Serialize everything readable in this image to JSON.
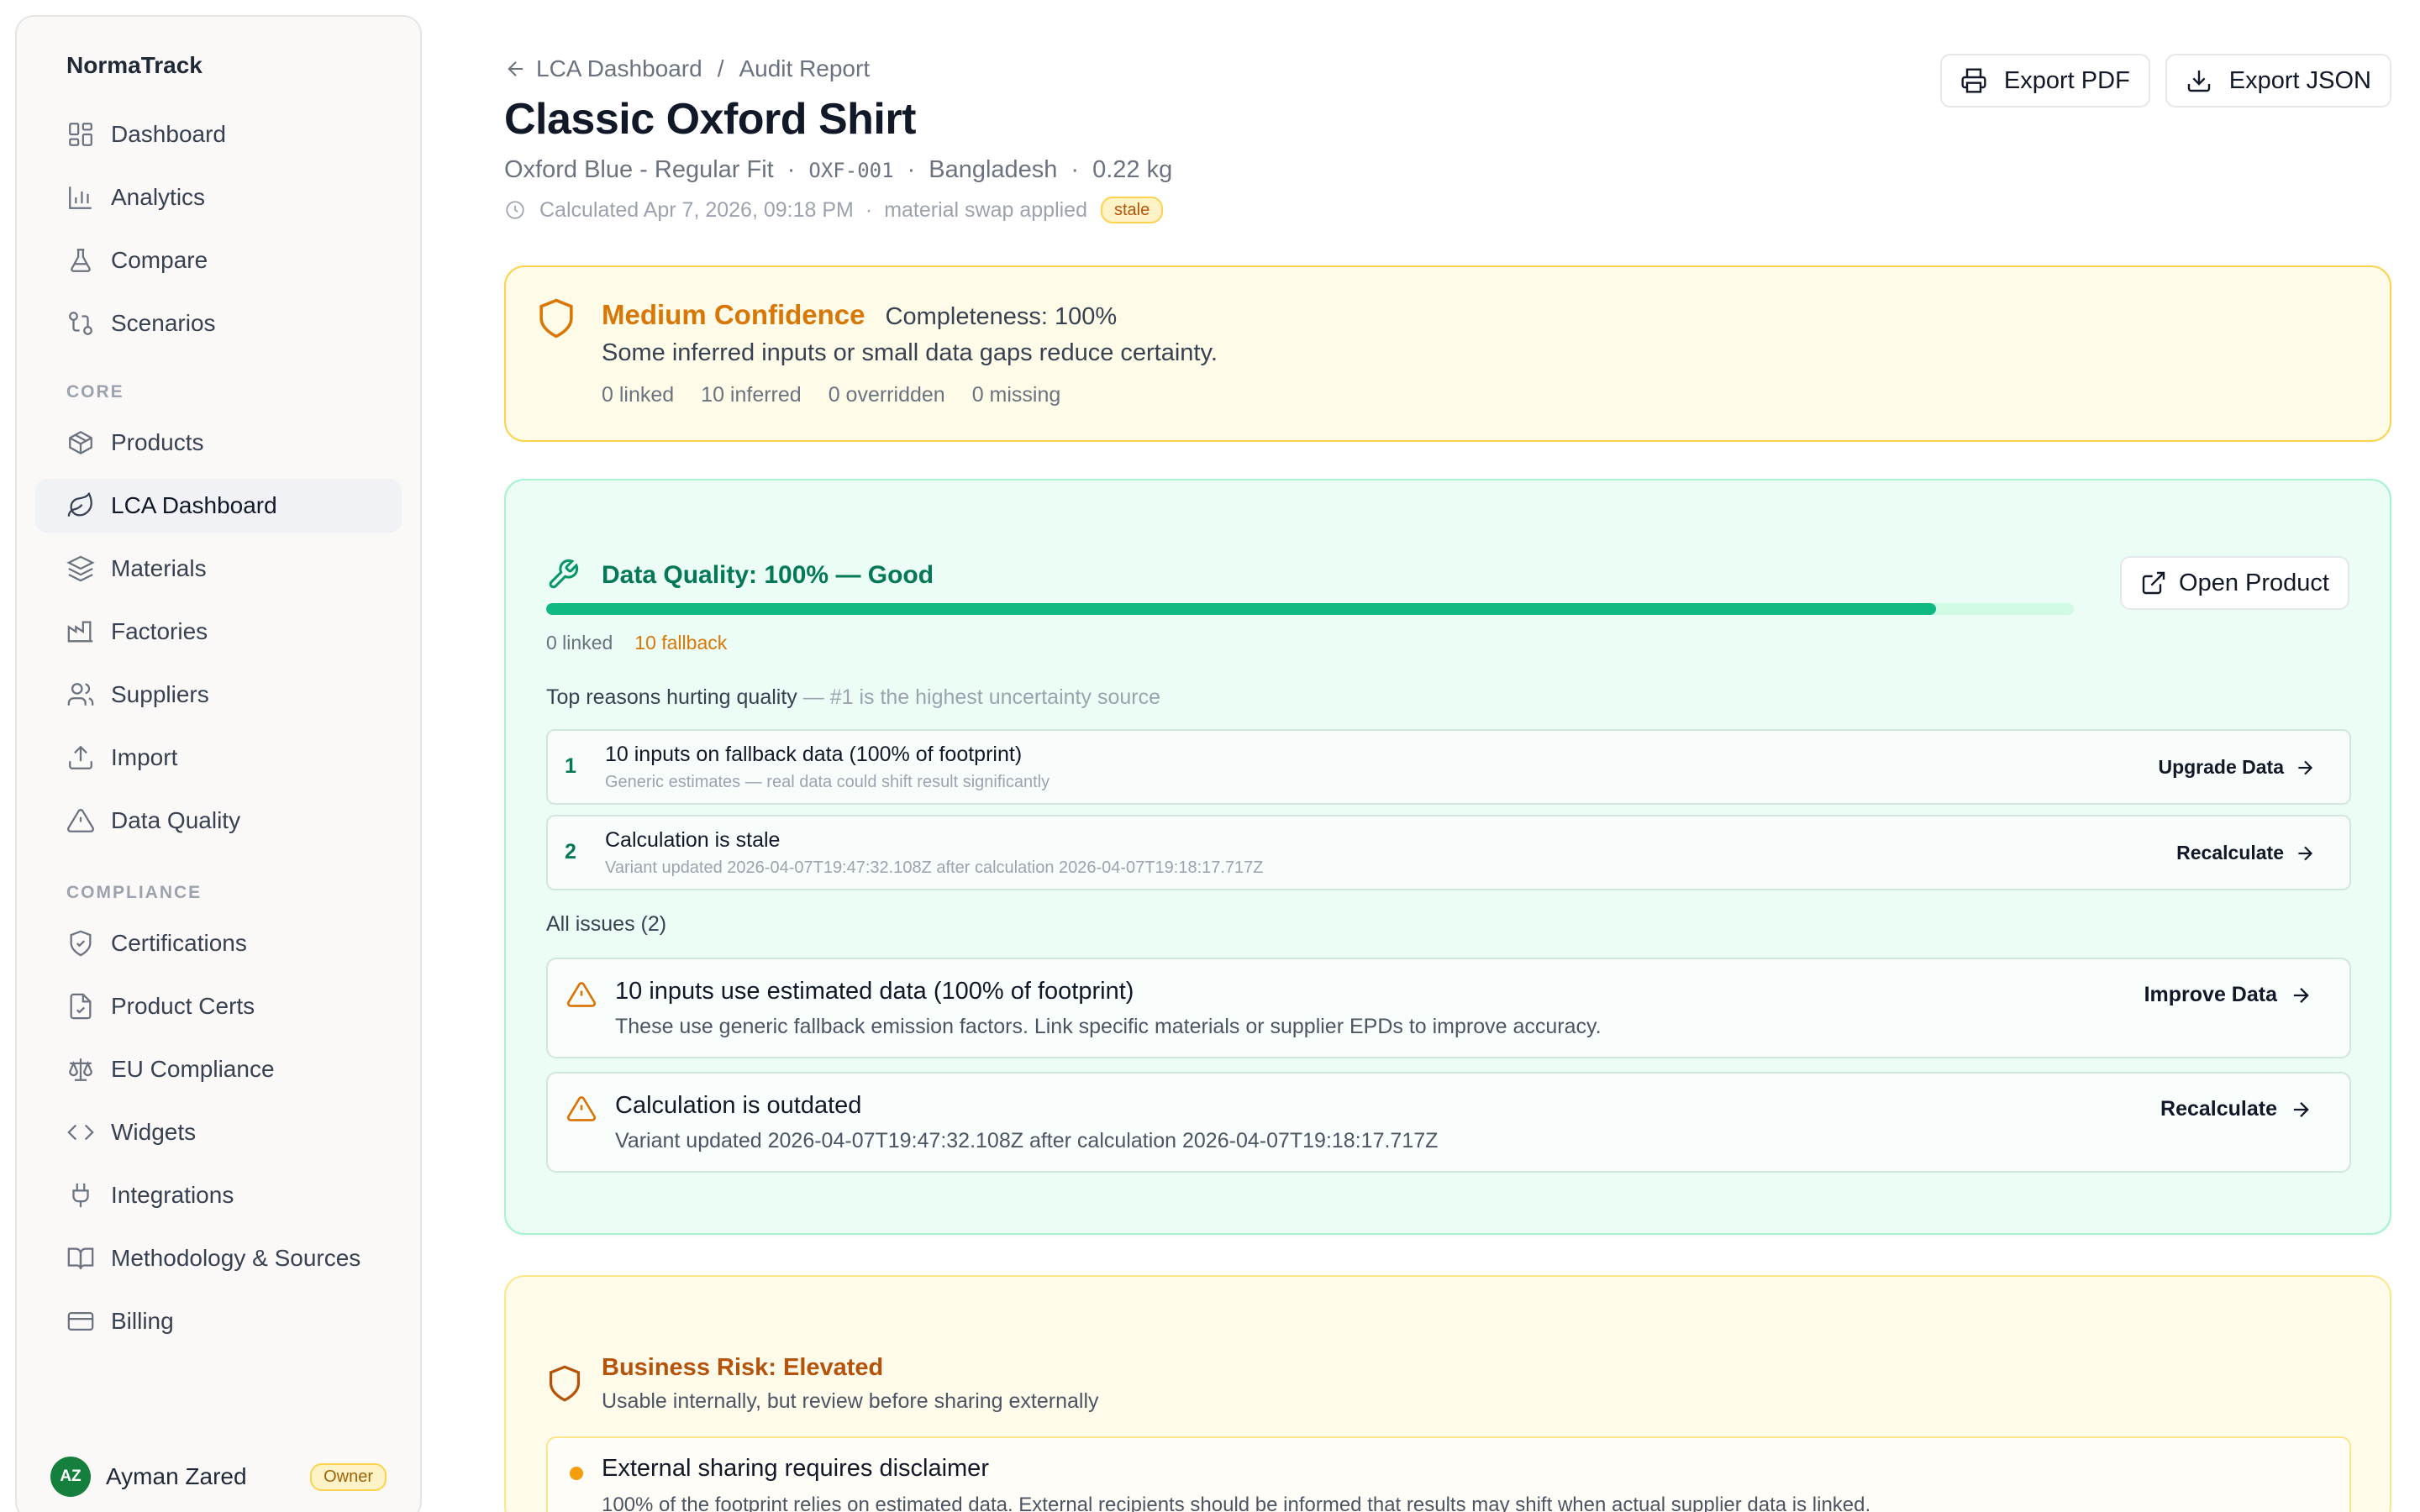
{
  "sidebar": {
    "brand": "NormaTrack",
    "top_items": [
      {
        "label": "Dashboard"
      },
      {
        "label": "Analytics"
      },
      {
        "label": "Compare"
      },
      {
        "label": "Scenarios"
      }
    ],
    "core_section": "CORE",
    "core_items": [
      {
        "label": "Products"
      },
      {
        "label": "LCA Dashboard"
      },
      {
        "label": "Materials"
      },
      {
        "label": "Factories"
      },
      {
        "label": "Suppliers"
      },
      {
        "label": "Import"
      },
      {
        "label": "Data Quality"
      }
    ],
    "compliance_section": "COMPLIANCE",
    "compliance_items": [
      {
        "label": "Certifications"
      },
      {
        "label": "Product Certs"
      },
      {
        "label": "EU Compliance"
      },
      {
        "label": "Widgets"
      },
      {
        "label": "Integrations"
      },
      {
        "label": "Methodology & Sources"
      },
      {
        "label": "Billing"
      }
    ],
    "user": {
      "initials": "AZ",
      "name": "Ayman Zared",
      "role": "Owner"
    }
  },
  "header": {
    "breadcrumb_parent": "LCA Dashboard",
    "breadcrumb_sep": "/",
    "breadcrumb_current": "Audit Report",
    "title": "Classic Oxford Shirt",
    "variant": "Oxford Blue - Regular Fit",
    "sku": "OXF-001",
    "country": "Bangladesh",
    "weight": "0.22 kg",
    "dot": "·",
    "calculated": "Calculated Apr 7, 2026, 09:18 PM",
    "note": "material swap applied",
    "status_badge": "stale",
    "export_pdf": "Export PDF",
    "export_json": "Export JSON"
  },
  "confidence": {
    "level": "Medium Confidence",
    "completeness": "Completeness: 100%",
    "description": "Some inferred inputs or small data gaps reduce certainty.",
    "stats": [
      "0 linked",
      "10 inferred",
      "0 overridden",
      "0 missing"
    ]
  },
  "data_quality": {
    "title": "Data Quality: 100% — Good",
    "progress": 0.91,
    "linked": "0 linked",
    "fallback": "10 fallback",
    "open_product": "Open Product",
    "reasons_heading": "Top reasons hurting quality",
    "reasons_subheading": " — #1 is the highest uncertainty source",
    "reasons": [
      {
        "num": "1",
        "title": "10 inputs on fallback data (100% of footprint)",
        "sub": "Generic estimates — real data could shift result significantly",
        "action": "Upgrade Data"
      },
      {
        "num": "2",
        "title": "Calculation is stale",
        "sub": "Variant updated 2026-04-07T19:47:32.108Z after calculation 2026-04-07T19:18:17.717Z",
        "action": "Recalculate"
      }
    ],
    "all_issues_label": "All issues (2)",
    "issues": [
      {
        "title": "10 inputs use estimated data (100% of footprint)",
        "sub": "These use generic fallback emission factors. Link specific materials or supplier EPDs to improve accuracy.",
        "action": "Improve Data"
      },
      {
        "title": "Calculation is outdated",
        "sub": "Variant updated 2026-04-07T19:47:32.108Z after calculation 2026-04-07T19:18:17.717Z",
        "action": "Recalculate"
      }
    ]
  },
  "business_risk": {
    "title": "Business Risk: Elevated",
    "subtitle": "Usable internally, but review before sharing externally",
    "item_title": "External sharing requires disclaimer",
    "item_sub": "100% of the footprint relies on estimated data. External recipients should be informed that results may shift when actual supplier data is linked."
  },
  "colors": {
    "accent_green": "#10b981",
    "warning_amber": "#d97706",
    "risk_orange": "#b45309"
  }
}
